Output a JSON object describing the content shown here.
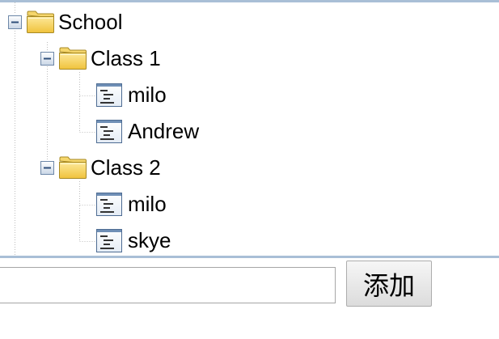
{
  "tree": {
    "root": {
      "label": "School",
      "expanded": true,
      "icon": "folder-icon",
      "children": [
        {
          "label": "Class 1",
          "expanded": true,
          "icon": "folder-icon",
          "children": [
            {
              "label": "milo",
              "icon": "document-icon"
            },
            {
              "label": "Andrew",
              "icon": "document-icon"
            }
          ]
        },
        {
          "label": "Class 2",
          "expanded": true,
          "icon": "folder-icon",
          "children": [
            {
              "label": "milo",
              "icon": "document-icon"
            },
            {
              "label": "skye",
              "icon": "document-icon"
            }
          ]
        }
      ]
    }
  },
  "form": {
    "input_value": "",
    "add_label": "添加"
  },
  "colors": {
    "panel_border": "#a9bfd6",
    "folder": "#f5cf55",
    "toggle_border": "#6d87a8"
  }
}
